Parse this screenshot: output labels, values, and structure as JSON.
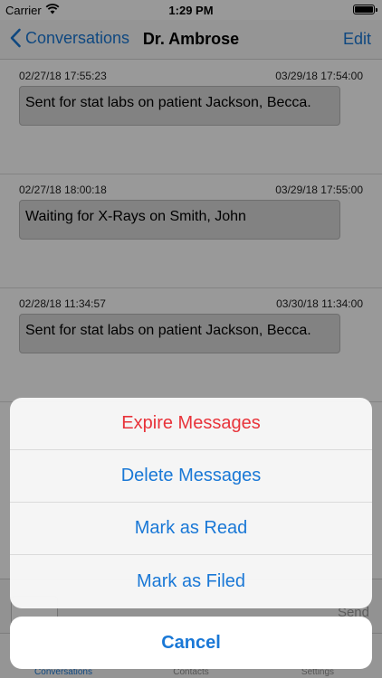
{
  "status_bar": {
    "carrier": "Carrier",
    "time": "1:29 PM",
    "battery_level": 1.0
  },
  "nav": {
    "back_label": "Conversations",
    "title": "Dr. Ambrose",
    "edit_label": "Edit"
  },
  "messages": [
    {
      "sent": "02/27/18 17:55:23",
      "expires": "03/29/18 17:54:00",
      "text": "Sent for stat labs on patient Jackson, Becca."
    },
    {
      "sent": "02/27/18 18:00:18",
      "expires": "03/29/18 17:55:00",
      "text": "Waiting for X-Rays on Smith, John"
    },
    {
      "sent": "02/28/18 11:34:57",
      "expires": "03/30/18 11:34:00",
      "text": "Sent for stat labs on patient Jackson, Becca."
    }
  ],
  "compose": {
    "send_label": "Send"
  },
  "tabs": [
    {
      "label": "Conversations",
      "active": true
    },
    {
      "label": "Contacts",
      "active": false
    },
    {
      "label": "Settings",
      "active": false
    }
  ],
  "action_sheet": {
    "actions": [
      {
        "label": "Expire Messages",
        "style": "destructive"
      },
      {
        "label": "Delete Messages",
        "style": "default"
      },
      {
        "label": "Mark as Read",
        "style": "default"
      },
      {
        "label": "Mark as Filed",
        "style": "default"
      }
    ],
    "cancel_label": "Cancel"
  },
  "colors": {
    "accent": "#1a78d6",
    "destructive": "#e8333a"
  }
}
